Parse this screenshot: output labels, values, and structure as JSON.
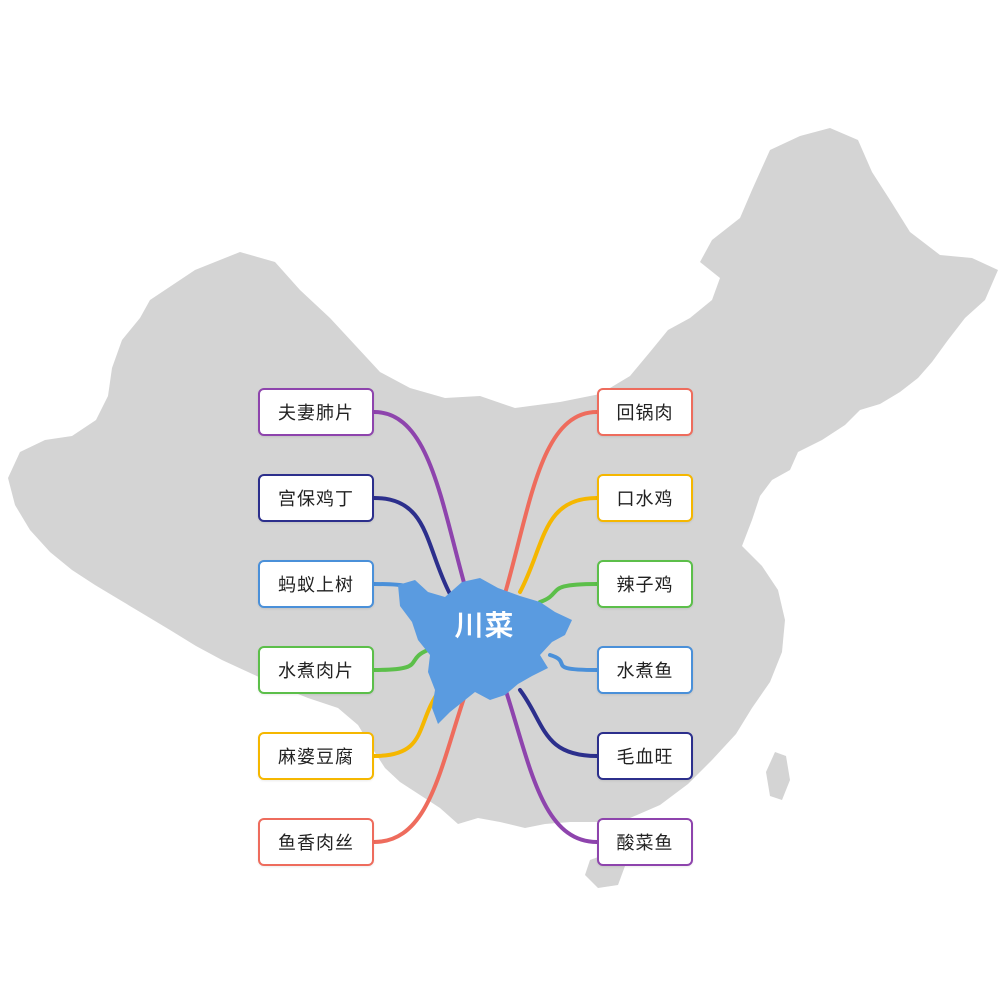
{
  "center": {
    "label": "川菜",
    "color": "#5a9be0"
  },
  "map": {
    "fill": "#d4d4d4"
  },
  "left_dishes": [
    {
      "label": "夫妻肺片",
      "color": "#8e44ad"
    },
    {
      "label": "宫保鸡丁",
      "color": "#2c2f8c"
    },
    {
      "label": "蚂蚁上树",
      "color": "#4a90d9"
    },
    {
      "label": "水煮肉片",
      "color": "#5cbf4a"
    },
    {
      "label": "麻婆豆腐",
      "color": "#f5b700"
    },
    {
      "label": "鱼香肉丝",
      "color": "#ee6c5d"
    }
  ],
  "right_dishes": [
    {
      "label": "回锅肉",
      "color": "#ee6c5d"
    },
    {
      "label": "口水鸡",
      "color": "#f5b700"
    },
    {
      "label": "辣子鸡",
      "color": "#5cbf4a"
    },
    {
      "label": "水煮鱼",
      "color": "#4a90d9"
    },
    {
      "label": "毛血旺",
      "color": "#2c2f8c"
    },
    {
      "label": "酸菜鱼",
      "color": "#8e44ad"
    }
  ]
}
